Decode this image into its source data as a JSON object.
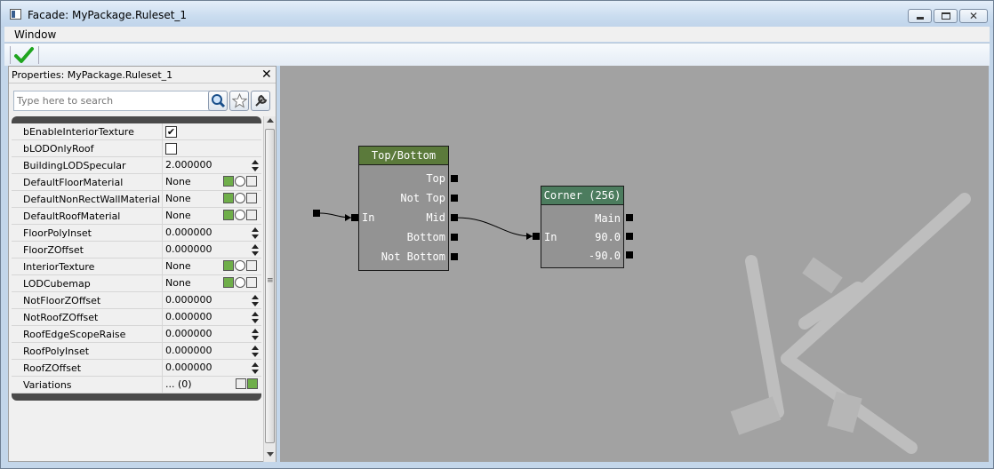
{
  "window": {
    "title": "Facade: MyPackage.Ruleset_1",
    "close_glyph": "✕"
  },
  "menu": {
    "items": [
      "Window"
    ]
  },
  "toolbar": {
    "apply_icon": "green-check-icon"
  },
  "properties": {
    "title": "Properties: MyPackage.Ruleset_1",
    "close_glyph": "✕",
    "search_placeholder": "Type here to search",
    "rows": [
      {
        "name": "bEnableInteriorTexture",
        "type": "checkbox",
        "value": "",
        "checked": true
      },
      {
        "name": "bLODOnlyRoof",
        "type": "checkbox",
        "value": "",
        "checked": false
      },
      {
        "name": "BuildingLODSpecular",
        "type": "number",
        "value": "2.000000"
      },
      {
        "name": "DefaultFloorMaterial",
        "type": "asset",
        "value": "None"
      },
      {
        "name": "DefaultNonRectWallMaterial",
        "type": "asset",
        "value": "None"
      },
      {
        "name": "DefaultRoofMaterial",
        "type": "asset",
        "value": "None"
      },
      {
        "name": "FloorPolyInset",
        "type": "number",
        "value": "0.000000"
      },
      {
        "name": "FloorZOffset",
        "type": "number",
        "value": "0.000000"
      },
      {
        "name": "InteriorTexture",
        "type": "asset",
        "value": "None"
      },
      {
        "name": "LODCubemap",
        "type": "asset",
        "value": "None"
      },
      {
        "name": "NotFloorZOffset",
        "type": "number",
        "value": "0.000000"
      },
      {
        "name": "NotRoofZOffset",
        "type": "number",
        "value": "0.000000"
      },
      {
        "name": "RoofEdgeScopeRaise",
        "type": "number",
        "value": "0.000000"
      },
      {
        "name": "RoofPolyInset",
        "type": "number",
        "value": "0.000000"
      },
      {
        "name": "RoofZOffset",
        "type": "number",
        "value": "0.000000"
      },
      {
        "name": "Variations",
        "type": "array",
        "value": "... (0)"
      }
    ]
  },
  "graph": {
    "nodes": {
      "top_bottom": {
        "title": "Top/Bottom",
        "inputs": [
          "In"
        ],
        "outputs": [
          "Top",
          "Not Top",
          "Mid",
          "Bottom",
          "Not Bottom"
        ]
      },
      "corner": {
        "title": "Corner (256)",
        "inputs": [
          "In"
        ],
        "outputs": [
          "Main",
          "90.0",
          "-90.0"
        ]
      }
    },
    "colors": {
      "canvas": "#a2a2a2",
      "node_body": "#939393",
      "title_top_bottom": "#5b7a3b",
      "title_corner": "#4c7c5e"
    }
  }
}
